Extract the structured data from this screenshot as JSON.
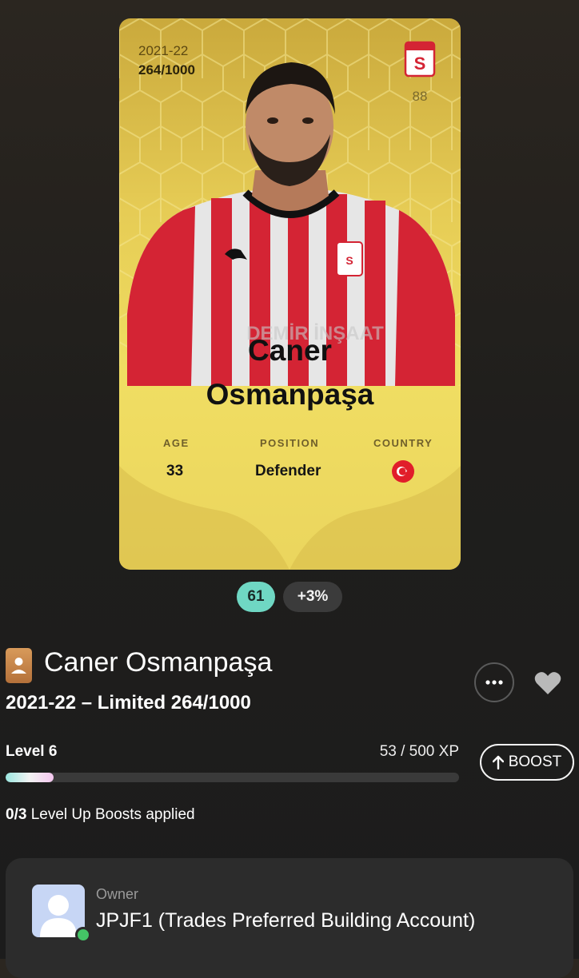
{
  "card": {
    "season": "2021-22",
    "serial": "264/1000",
    "club_rank": "88",
    "first_name": "Caner",
    "last_name": "Osmanpaşa",
    "stats": {
      "age_label": "AGE",
      "age": "33",
      "position_label": "POSITION",
      "position": "Defender",
      "country_label": "COUNTRY"
    },
    "jersey_sponsor": "DEMİR İNŞAAT"
  },
  "scores": {
    "score": "61",
    "bonus": "+3%"
  },
  "header": {
    "title": "Caner Osmanpaşa",
    "subtitle": "2021-22 – Limited 264/1000"
  },
  "level": {
    "label": "Level 6",
    "xp_text": "53 / 500 XP",
    "xp_progress": 0.106,
    "boost_label": "BOOST",
    "boosts_applied_count": "0/3",
    "boosts_applied_text": " Level Up Boosts applied"
  },
  "owner": {
    "label": "Owner",
    "name": "JPJF1 (Trades Preferred Building Account)"
  },
  "colors": {
    "score_pill": "#6fd7c3",
    "card_gold": "#e6cc55",
    "online": "#44c466"
  },
  "icons": [
    "more-icon",
    "heart-icon",
    "arrow-up-icon",
    "rarity-icon",
    "turkey-flag-icon",
    "club-badge-icon"
  ]
}
